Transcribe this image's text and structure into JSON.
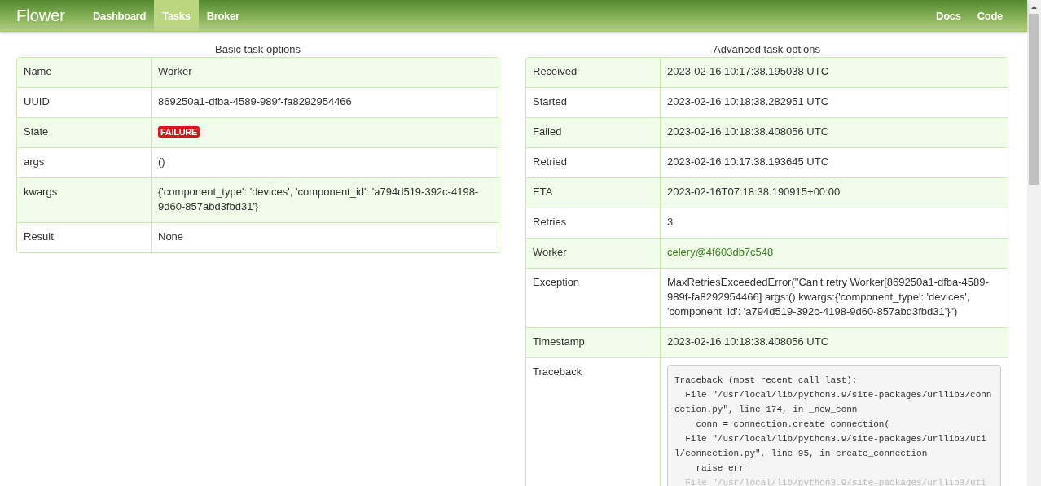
{
  "navbar": {
    "brand": "Flower",
    "tabs": [
      {
        "label": "Dashboard",
        "selected": false
      },
      {
        "label": "Tasks",
        "selected": true
      },
      {
        "label": "Broker",
        "selected": false
      }
    ],
    "links": [
      "Docs",
      "Code"
    ]
  },
  "basic": {
    "title": "Basic task options",
    "rows": [
      {
        "label": "Name",
        "kind": "text",
        "value": "Worker"
      },
      {
        "label": "UUID",
        "kind": "text",
        "value": "869250a1-dfba-4589-989f-fa8292954466"
      },
      {
        "label": "State",
        "kind": "badge",
        "value": "FAILURE"
      },
      {
        "label": "args",
        "kind": "text",
        "value": "()"
      },
      {
        "label": "kwargs",
        "kind": "text",
        "value": "{'component_type': 'devices', 'component_id': 'a794d519-392c-4198-9d60-857abd3fbd31'}"
      },
      {
        "label": "Result",
        "kind": "text",
        "value": "None"
      }
    ]
  },
  "advanced": {
    "title": "Advanced task options",
    "rows": [
      {
        "label": "Received",
        "kind": "text",
        "value": "2023-02-16 10:17:38.195038 UTC"
      },
      {
        "label": "Started",
        "kind": "text",
        "value": "2023-02-16 10:18:38.282951 UTC"
      },
      {
        "label": "Failed",
        "kind": "text",
        "value": "2023-02-16 10:18:38.408056 UTC"
      },
      {
        "label": "Retried",
        "kind": "text",
        "value": "2023-02-16 10:17:38.193645 UTC"
      },
      {
        "label": "ETA",
        "kind": "text",
        "value": "2023-02-16T07:18:38.190915+00:00"
      },
      {
        "label": "Retries",
        "kind": "text",
        "value": "3"
      },
      {
        "label": "Worker",
        "kind": "link",
        "value": "celery@4f603db7c548"
      },
      {
        "label": "Exception",
        "kind": "text",
        "value": "MaxRetriesExceededError(\"Can't retry Worker[869250a1-dfba-4589-989f-fa8292954466] args:() kwargs:{'component_type': 'devices', 'component_id': 'a794d519-392c-4198-9d60-857abd3fbd31'}\")"
      },
      {
        "label": "Timestamp",
        "kind": "text",
        "value": "2023-02-16 10:18:38.408056 UTC"
      },
      {
        "label": "Traceback",
        "kind": "code",
        "lines": [
          "Traceback (most recent call last):",
          "  File \"/usr/local/lib/python3.9/site-packages/urllib3/conn",
          "ection.py\", line 174, in _new_conn",
          "    conn = connection.create_connection(",
          "  File \"/usr/local/lib/python3.9/site-packages/urllib3/uti",
          "l/connection.py\", line 95, in create_connection",
          "    raise err",
          "  File \"/usr/local/lib/python3.9/site-packages/urllib3/uti"
        ]
      }
    ]
  }
}
